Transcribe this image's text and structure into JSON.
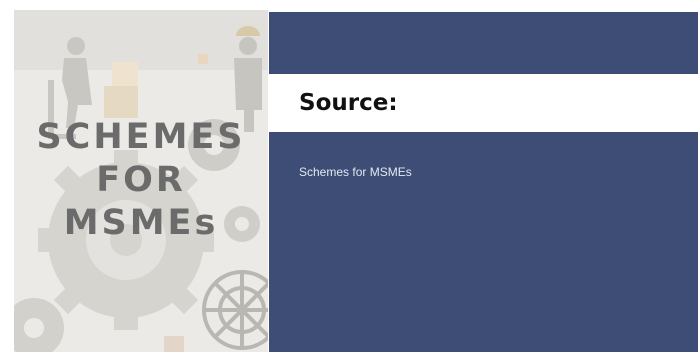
{
  "image": {
    "title_lines": [
      "SCHEMES",
      "FOR",
      "MSMEs"
    ]
  },
  "source": {
    "heading": "Source:",
    "items": [
      "Schemes for MSMEs"
    ]
  },
  "colors": {
    "panel_background": "#3d4d75",
    "band_background": "#ffffff",
    "image_title": "#6b6b6b"
  }
}
